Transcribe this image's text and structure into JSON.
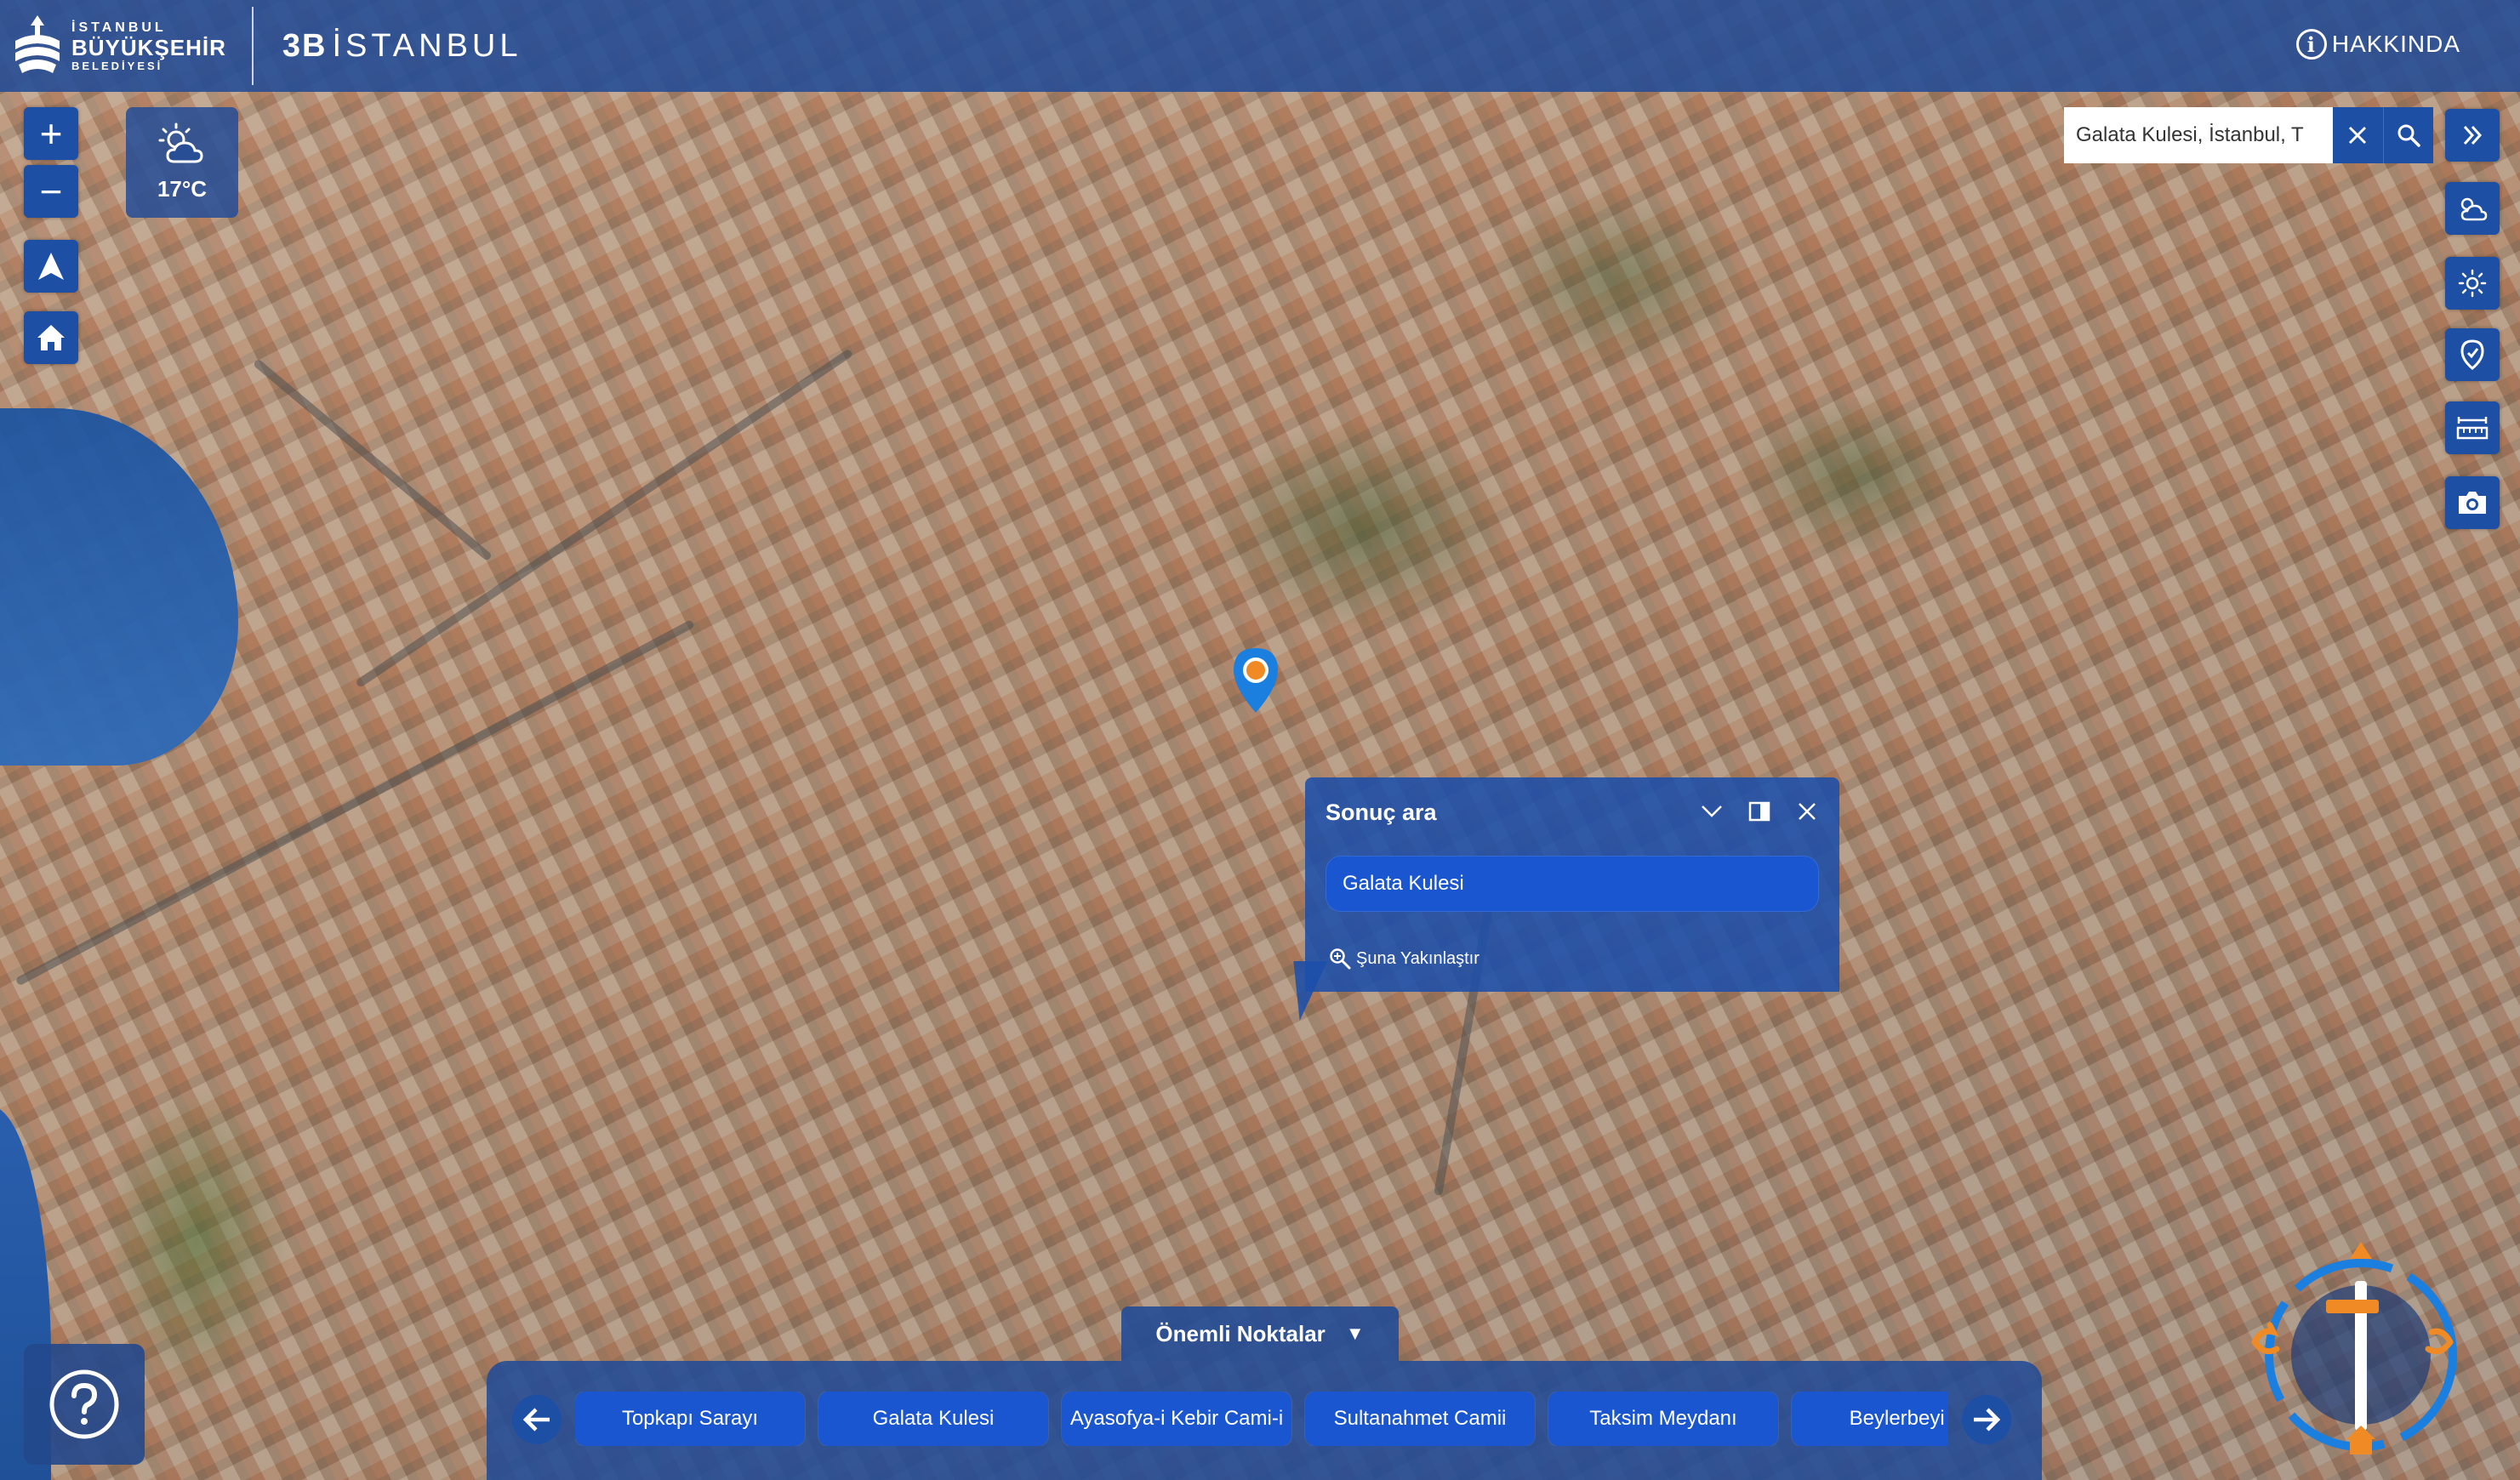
{
  "header": {
    "logo_line1": "İSTANBUL",
    "logo_line2": "BÜYÜKŞEHİR",
    "logo_line3": "BELEDİYESİ",
    "app_title_bold": "3B",
    "app_title": "İSTANBUL",
    "about_label": "HAKKINDA"
  },
  "left_controls": {
    "zoom_in": "+",
    "zoom_out": "−"
  },
  "weather": {
    "icon": "partly-cloudy-icon",
    "temperature": "17°C"
  },
  "search": {
    "value": "Galata Kulesi, İstanbul, T"
  },
  "right_tools": [
    "expand-icon",
    "weather-icon",
    "sun-icon",
    "location-icon",
    "measure-icon",
    "camera-icon"
  ],
  "popup": {
    "title": "Sonuç ara",
    "result": "Galata Kulesi",
    "zoom_link": "Şuna Yakınlaştır"
  },
  "landmarks": {
    "toggle_label": "Önemli Noktalar",
    "items": [
      {
        "label": "Topkapı Sarayı"
      },
      {
        "label": "Galata Kulesi"
      },
      {
        "label": "Ayasofya-i Kebir Cami-i"
      },
      {
        "label": "Sultanahmet Camii"
      },
      {
        "label": "Taksim Meydanı"
      },
      {
        "label": "Beylerbeyi S"
      }
    ]
  },
  "colors": {
    "header_bg": "#224b96",
    "button_bg": "#1d4fa5",
    "accent_orange": "#f08a24",
    "pin_blue": "#1b7fe0"
  }
}
